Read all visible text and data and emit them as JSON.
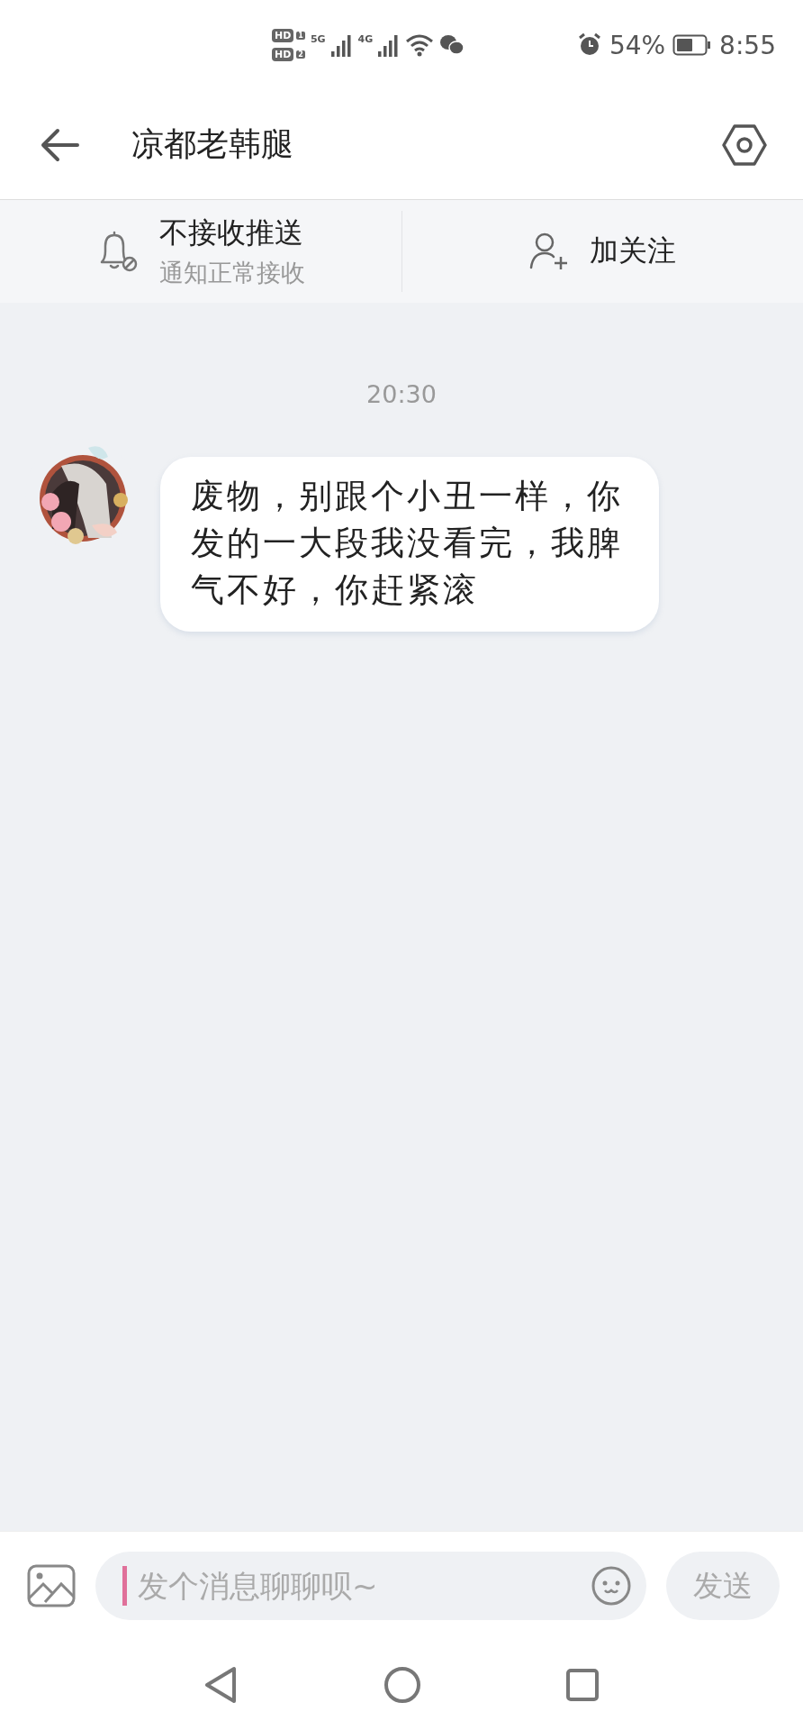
{
  "status_bar": {
    "sims": [
      {
        "label": "HD",
        "slot": "1"
      },
      {
        "label": "HD",
        "slot": "2"
      }
    ],
    "networks": [
      {
        "label": "5G"
      },
      {
        "label": "4G"
      }
    ],
    "battery_text": "54%",
    "time": "8:55"
  },
  "header": {
    "title": "凉都老韩腿"
  },
  "action_bar": {
    "notify": {
      "title": "不接收推送",
      "subtitle": "通知正常接收"
    },
    "follow": {
      "label": "加关注"
    }
  },
  "messages": [
    {
      "kind": "time",
      "text": "20:30"
    },
    {
      "kind": "received",
      "text": "废物，别跟个小丑一样，你发的一大段我没看完，我脾气不好，你赶紧滚"
    }
  ],
  "composer": {
    "placeholder": "发个消息聊聊呗~",
    "send_label": "发送"
  }
}
